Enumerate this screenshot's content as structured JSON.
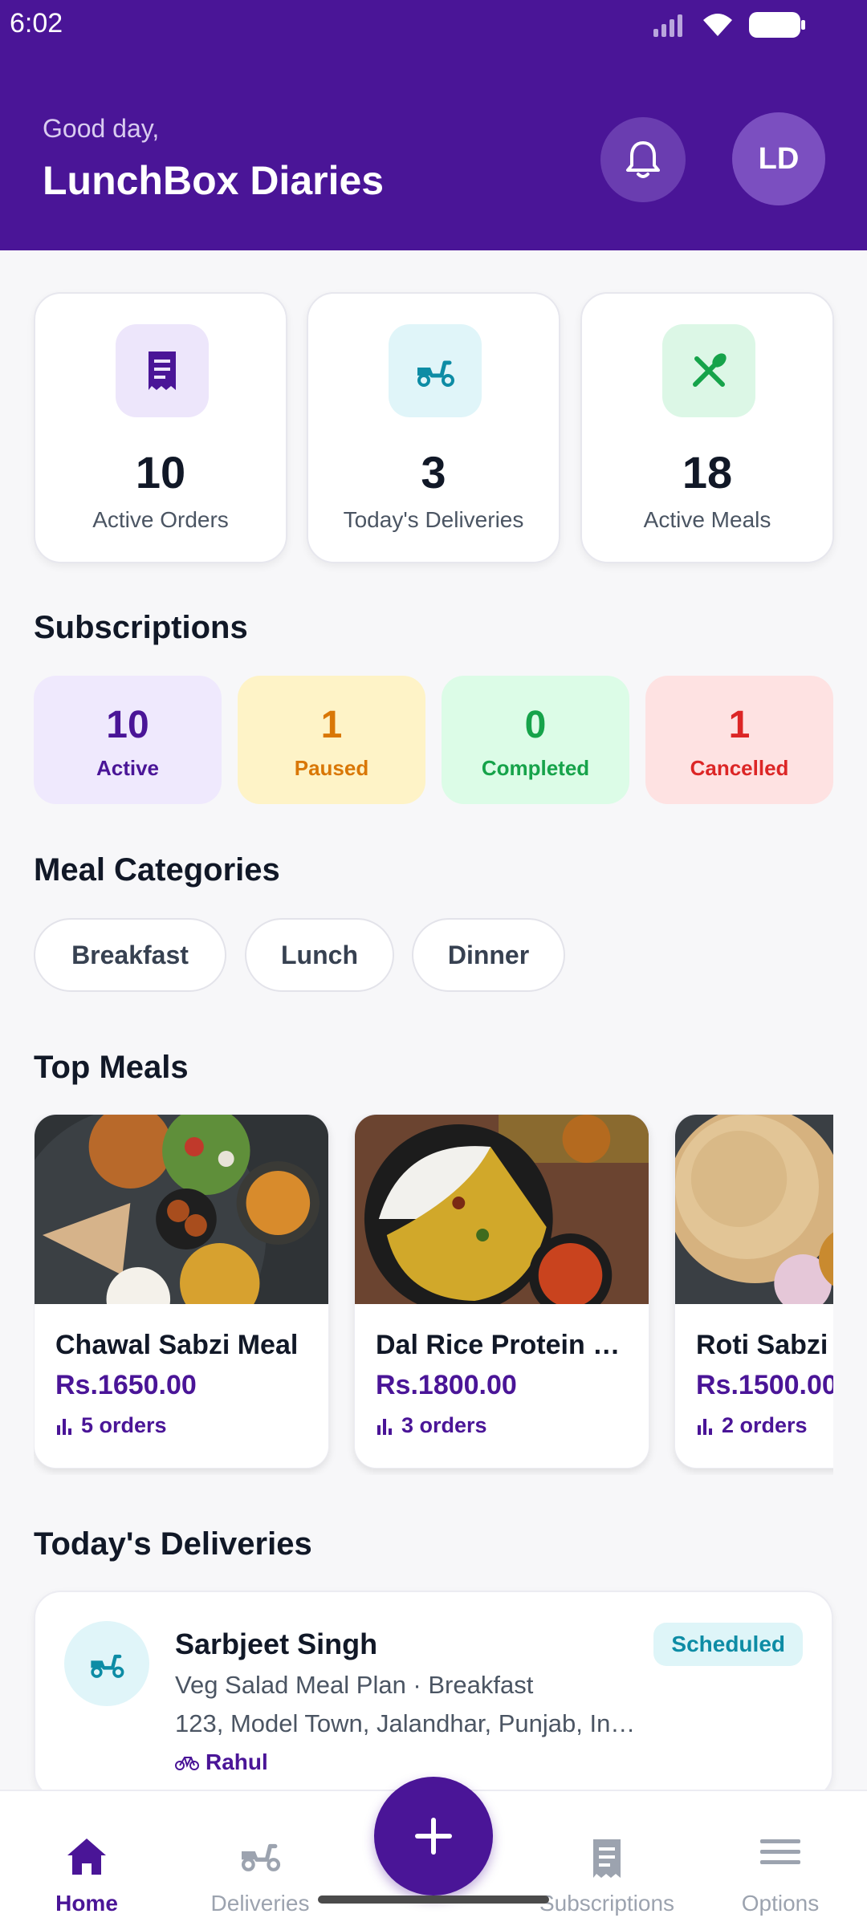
{
  "status_bar": {
    "time": "6:02"
  },
  "header": {
    "greeting": "Good day,",
    "title": "LunchBox Diaries",
    "avatar_initials": "LD",
    "bg_color": "#4a1597"
  },
  "stats": [
    {
      "value": "10",
      "label": "Active Orders",
      "icon": "receipt-icon",
      "icon_bg": "#ede6fb",
      "icon_color": "#4a1597"
    },
    {
      "value": "3",
      "label": "Today's Deliveries",
      "icon": "scooter-icon",
      "icon_bg": "#e0f5f9",
      "icon_color": "#0d8ca5"
    },
    {
      "value": "18",
      "label": "Active Meals",
      "icon": "cutlery-icon",
      "icon_bg": "#dcf7e6",
      "icon_color": "#16a34a"
    }
  ],
  "subscriptions": {
    "title": "Subscriptions",
    "tiles": [
      {
        "value": "10",
        "label": "Active",
        "bg": "#efe9fd",
        "color": "#4a1597"
      },
      {
        "value": "1",
        "label": "Paused",
        "bg": "#fef3c7",
        "color": "#d97706"
      },
      {
        "value": "0",
        "label": "Completed",
        "bg": "#dcfce7",
        "color": "#16a34a"
      },
      {
        "value": "1",
        "label": "Cancelled",
        "bg": "#fee2e2",
        "color": "#dc2626"
      }
    ]
  },
  "categories": {
    "title": "Meal Categories",
    "items": [
      "Breakfast",
      "Lunch",
      "Dinner"
    ]
  },
  "top_meals": {
    "title": "Top Meals",
    "items": [
      {
        "name": "Chawal Sabzi Meal",
        "price": "Rs.1650.00",
        "orders": "5 orders"
      },
      {
        "name": "Dal Rice Protein …",
        "price": "Rs.1800.00",
        "orders": "3 orders"
      },
      {
        "name": "Roti Sabzi Meal",
        "price": "Rs.1500.00",
        "orders": "2 orders"
      }
    ]
  },
  "deliveries": {
    "title": "Today's Deliveries",
    "items": [
      {
        "name": "Sarbjeet Singh",
        "plan": "Veg Salad Meal Plan · Breakfast",
        "address": "123, Model Town, Jalandhar, Punjab, In…",
        "rider": "Rahul",
        "status": "Scheduled"
      }
    ]
  },
  "nav": {
    "items": [
      {
        "label": "Home",
        "icon": "home-icon",
        "active": true
      },
      {
        "label": "Deliveries",
        "icon": "scooter-icon",
        "active": false
      },
      {
        "label": "Subscriptions",
        "icon": "receipt-icon",
        "active": false
      },
      {
        "label": "Options",
        "icon": "menu-icon",
        "active": false
      }
    ],
    "fab_icon": "plus-icon"
  }
}
